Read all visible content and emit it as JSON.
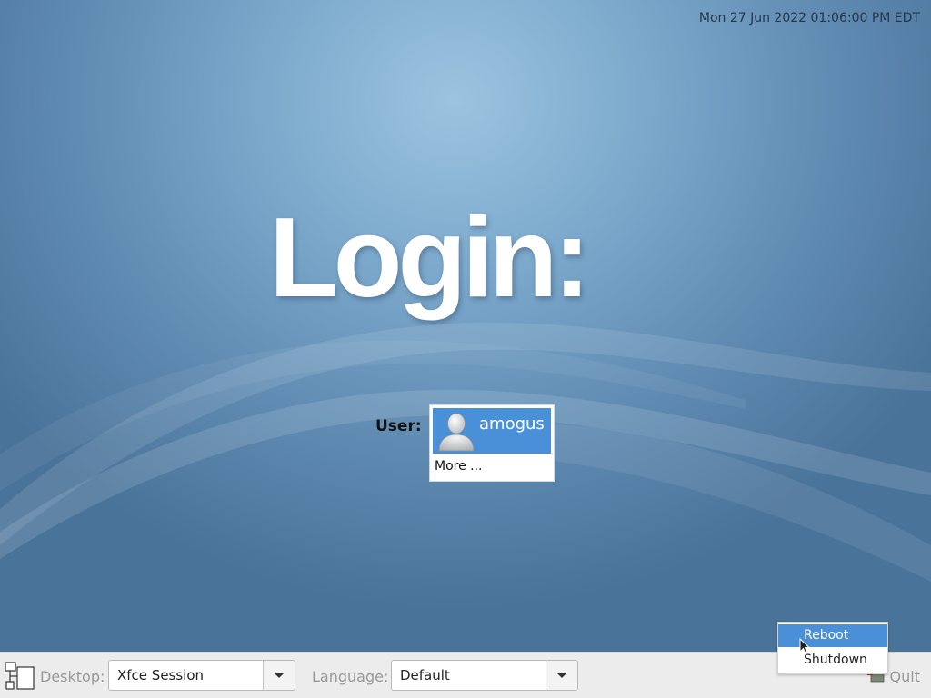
{
  "clock": "Mon 27 Jun 2022 01:06:00 PM EDT",
  "title": "Login:",
  "user_label": "User:",
  "users": [
    {
      "name": "amogus",
      "icon": "user-avatar-icon",
      "selected": true
    }
  ],
  "more_label": "More ...",
  "bottom_bar": {
    "desktop_label": "Desktop:",
    "desktop_value": "Xfce Session",
    "language_label": "Language:",
    "language_value": "Default",
    "quit_label": "Quit"
  },
  "quit_menu": {
    "items": [
      {
        "label": "Reboot",
        "highlighted": true
      },
      {
        "label": "Shutdown",
        "highlighted": false
      }
    ]
  },
  "colors": {
    "selection": "#4a90d9",
    "background": "#5e89b0",
    "bar": "#ececec"
  }
}
